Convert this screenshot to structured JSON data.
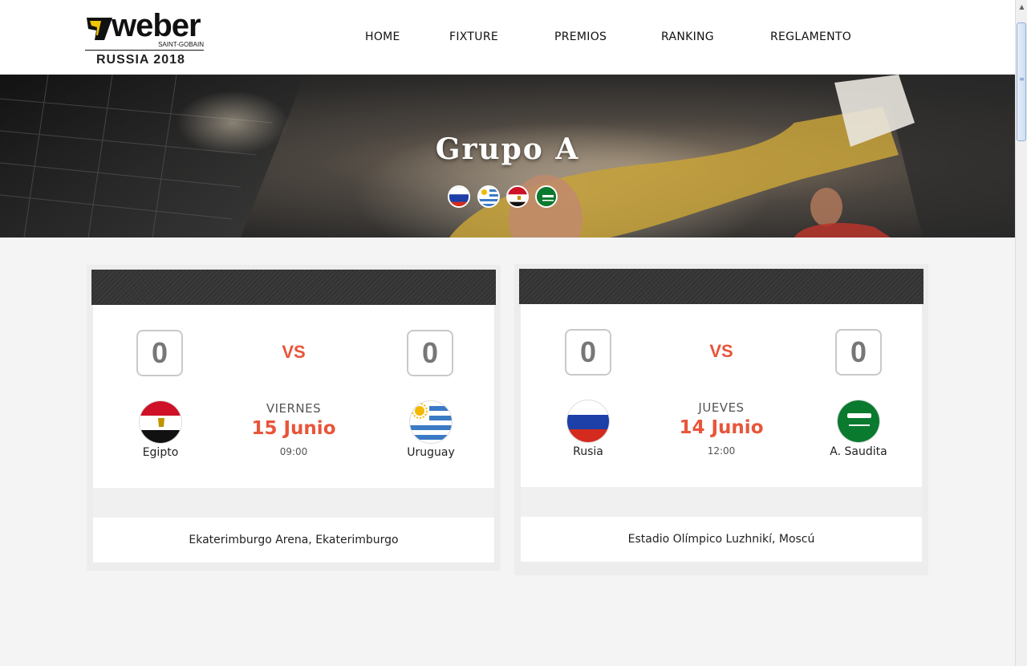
{
  "header": {
    "logo": {
      "word": "weber",
      "sub": "SAINT-GOBAIN",
      "year": "RUSSIA 2018"
    },
    "nav": [
      {
        "label": "HOME"
      },
      {
        "label": "FIXTURE"
      },
      {
        "label": "PREMIOS"
      },
      {
        "label": "RANKING"
      },
      {
        "label": "REGLAMENTO"
      }
    ]
  },
  "hero": {
    "title": "Grupo A",
    "flags": [
      "russia-flag",
      "uruguay-flag",
      "egypt-flag",
      "saudi-arabia-flag"
    ]
  },
  "matches": [
    {
      "home": {
        "name": "Egipto",
        "score": "0",
        "flag": "egypt-flag"
      },
      "away": {
        "name": "Uruguay",
        "score": "0",
        "flag": "uruguay-flag"
      },
      "vs": "VS",
      "day": "VIERNES",
      "date": "15 Junio",
      "time": "09:00",
      "venue": "Ekaterimburgo Arena, Ekaterimburgo"
    },
    {
      "home": {
        "name": "Rusia",
        "score": "0",
        "flag": "russia-flag"
      },
      "away": {
        "name": "A. Saudita",
        "score": "0",
        "flag": "saudi-arabia-flag"
      },
      "vs": "VS",
      "day": "JUEVES",
      "date": "14 Junio",
      "time": "12:00",
      "venue": "Estadio Olímpico Luzhnikí, Moscú"
    }
  ],
  "colors": {
    "accent": "#e8553a",
    "card_header": "#353535",
    "background": "#f4f4f4"
  }
}
